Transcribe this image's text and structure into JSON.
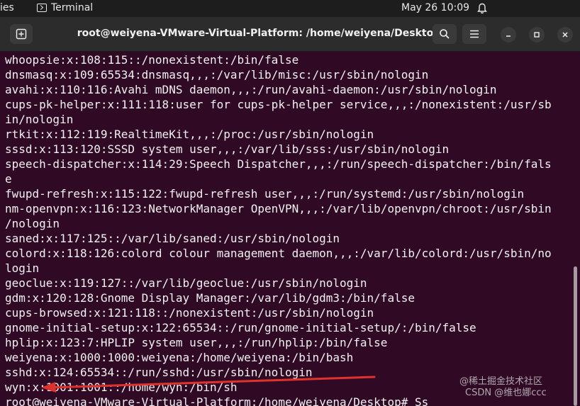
{
  "top_bar": {
    "activities_label": "ies",
    "app_label": "Terminal",
    "app_icon": "terminal-icon",
    "clock": "May 26  10:09",
    "notification_icon": "bell-icon"
  },
  "window": {
    "title": "root@weiyena-VMware-Virtual-Platform: /home/weiyena/Desktop",
    "new_tab_icon": "new-tab-icon",
    "search_icon": "search-icon",
    "menu_icon": "hamburger-menu-icon",
    "minimize_icon": "minimize-icon",
    "maximize_icon": "maximize-icon",
    "close_icon": "close-icon"
  },
  "terminal": {
    "background": "#300a24",
    "lines": [
      "whoopsie:x:108:115::/nonexistent:/bin/false",
      "dnsmasq:x:109:65534:dnsmasq,,,:/var/lib/misc:/usr/sbin/nologin",
      "avahi:x:110:116:Avahi mDNS daemon,,,:/run/avahi-daemon:/usr/sbin/nologin",
      "cups-pk-helper:x:111:118:user for cups-pk-helper service,,,:/nonexistent:/usr/sb",
      "in/nologin",
      "rtkit:x:112:119:RealtimeKit,,,:/proc:/usr/sbin/nologin",
      "sssd:x:113:120:SSSD system user,,,:/var/lib/sss:/usr/sbin/nologin",
      "speech-dispatcher:x:114:29:Speech Dispatcher,,,:/run/speech-dispatcher:/bin/fals",
      "e",
      "fwupd-refresh:x:115:122:fwupd-refresh user,,,:/run/systemd:/usr/sbin/nologin",
      "nm-openvpn:x:116:123:NetworkManager OpenVPN,,,:/var/lib/openvpn/chroot:/usr/sbin",
      "/nologin",
      "saned:x:117:125::/var/lib/saned:/usr/sbin/nologin",
      "colord:x:118:126:colord colour management daemon,,,:/var/lib/colord:/usr/sbin/no",
      "login",
      "geoclue:x:119:127::/var/lib/geoclue:/usr/sbin/nologin",
      "gdm:x:120:128:Gnome Display Manager:/var/lib/gdm3:/bin/false",
      "cups-browsed:x:121:118::/nonexistent:/usr/sbin/nologin",
      "gnome-initial-setup:x:122:65534::/run/gnome-initial-setup/:/bin/false",
      "hplip:x:123:7:HPLIP system user,,,:/run/hplip:/bin/false",
      "weiyena:x:1000:1000:weiyena:/home/weiyena:/bin/bash",
      "sshd:x:124:65534::/run/sshd:/usr/sbin/nologin",
      "wyn:x:1001:1001::/home/wyn:/bin/sh",
      "root@weiyena-VMware-Virtual-Platform:/home/weiyena/Desktop# Ss"
    ]
  },
  "annotation": {
    "arrow_color": "#e0322d"
  },
  "watermark": {
    "line1": "@稀土掘金技术社区",
    "line2": "CSDN @维也娜ccc"
  }
}
